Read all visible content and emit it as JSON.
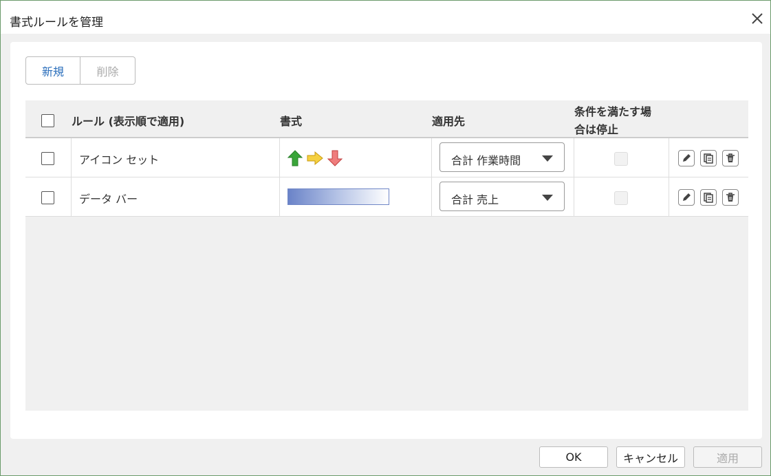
{
  "dialog": {
    "title": "書式ルールを管理"
  },
  "toolbar": {
    "new_label": "新規",
    "delete_label": "削除"
  },
  "grid": {
    "headers": {
      "rule": "ルール (表示順で適用)",
      "format": "書式",
      "applies_to": "適用先",
      "stop_if_true_line1": "条件を満たす場",
      "stop_if_true_line2": "合は停止"
    },
    "rows": [
      {
        "name": "アイコン セット",
        "format_type": "icon-set",
        "applies_to": "合計 作業時間",
        "stop_if_true": false
      },
      {
        "name": "データ バー",
        "format_type": "data-bar",
        "applies_to": "合計 売上",
        "stop_if_true": false
      }
    ]
  },
  "footer": {
    "ok_label": "OK",
    "cancel_label": "キャンセル",
    "apply_label": "適用"
  },
  "colors": {
    "accent": "#2a6ebb",
    "arrow_up": "#3aa53a",
    "arrow_right": "#f0c030",
    "arrow_down": "#e05050",
    "data_bar": "#6a83c8"
  }
}
